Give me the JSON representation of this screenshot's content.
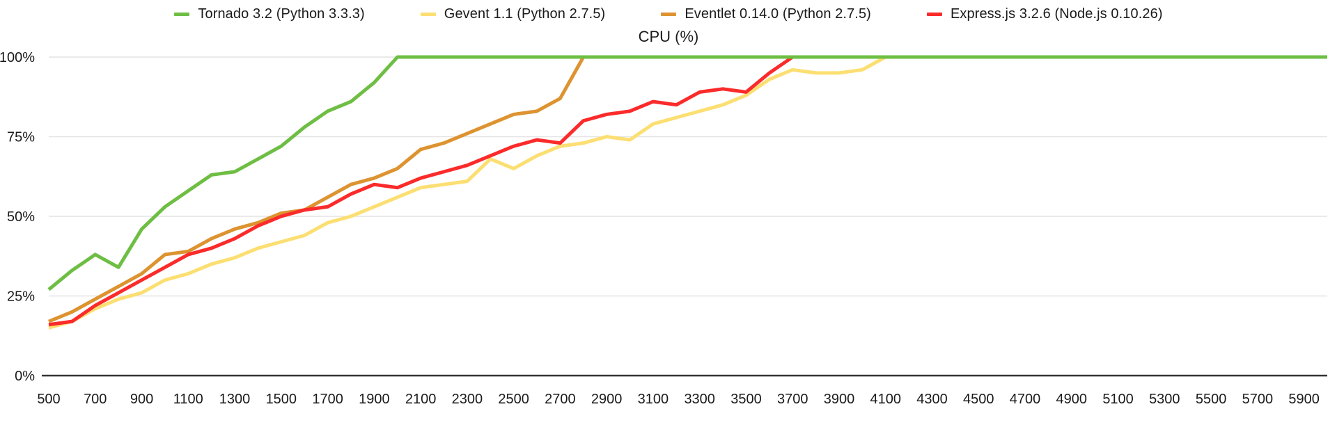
{
  "chart_data": {
    "type": "line",
    "title": "CPU (%)",
    "xlabel": "",
    "ylabel": "",
    "grid": true,
    "legend_position": "top",
    "xlim": [
      500,
      6000
    ],
    "ylim": [
      0,
      100
    ],
    "y_ticks": [
      0,
      25,
      50,
      75,
      100
    ],
    "y_tick_labels": [
      "0%",
      "25%",
      "50%",
      "75%",
      "100%"
    ],
    "x_tick_labels": [
      "500",
      "700",
      "900",
      "1100",
      "1300",
      "1500",
      "1700",
      "1900",
      "2100",
      "2300",
      "2500",
      "2700",
      "2900",
      "3100",
      "3300",
      "3500",
      "3700",
      "3900",
      "4100",
      "4300",
      "4500",
      "4700",
      "4900",
      "5100",
      "5300",
      "5500",
      "5700",
      "5900"
    ],
    "x": [
      500,
      600,
      700,
      800,
      900,
      1000,
      1100,
      1200,
      1300,
      1400,
      1500,
      1600,
      1700,
      1800,
      1900,
      2000,
      2100,
      2200,
      2300,
      2400,
      2500,
      2600,
      2700,
      2800,
      2900,
      3000,
      3100,
      3200,
      3300,
      3400,
      3500,
      3600,
      3700,
      3800,
      3900,
      4000,
      4100,
      4200,
      4300,
      4400,
      4500,
      4600,
      4700,
      4800,
      4900,
      5000,
      5100,
      5200,
      5300,
      5400,
      5500,
      5600,
      5700,
      5800,
      5900,
      6000
    ],
    "series": [
      {
        "name": "Tornado 3.2 (Python 3.3.3)",
        "color": "#6ebe44",
        "values": [
          27,
          33,
          38,
          34,
          46,
          53,
          58,
          63,
          64,
          68,
          72,
          78,
          83,
          86,
          92,
          100,
          100,
          100,
          100,
          100,
          100,
          100,
          100,
          100,
          100,
          100,
          100,
          100,
          100,
          100,
          100,
          100,
          100,
          100,
          100,
          100,
          100,
          100,
          100,
          100,
          100,
          100,
          100,
          100,
          100,
          100,
          100,
          100,
          100,
          100,
          100,
          100,
          100,
          100,
          100,
          100
        ]
      },
      {
        "name": "Gevent 1.1 (Python 2.7.5)",
        "color": "#fcdf72",
        "values": [
          15,
          17,
          21,
          24,
          26,
          30,
          32,
          35,
          37,
          40,
          42,
          44,
          48,
          50,
          53,
          56,
          59,
          60,
          61,
          68,
          65,
          69,
          72,
          73,
          75,
          74,
          79,
          81,
          83,
          85,
          88,
          93,
          96,
          95,
          95,
          96,
          100,
          100,
          100,
          100,
          100,
          100,
          100,
          100,
          100,
          100,
          100,
          100,
          100,
          100,
          100,
          100,
          100,
          100,
          100,
          100
        ]
      },
      {
        "name": "Eventlet 0.14.0 (Python 2.7.5)",
        "color": "#dd9330",
        "values": [
          17,
          20,
          24,
          28,
          32,
          38,
          39,
          43,
          46,
          48,
          51,
          52,
          56,
          60,
          62,
          65,
          71,
          73,
          76,
          79,
          82,
          83,
          87,
          100,
          100,
          100,
          100,
          100,
          100,
          100,
          100,
          100,
          100,
          100,
          100,
          100,
          100,
          100,
          100,
          100,
          100,
          100,
          100,
          100,
          100,
          100,
          100,
          100,
          100,
          100,
          100,
          100,
          100,
          100,
          100,
          100
        ]
      },
      {
        "name": "Express.js 3.2.6 (Node.js 0.10.26)",
        "color": "#fb2b2b",
        "values": [
          16,
          17,
          22,
          26,
          30,
          34,
          38,
          40,
          43,
          47,
          50,
          52,
          53,
          57,
          60,
          59,
          62,
          64,
          66,
          69,
          72,
          74,
          73,
          80,
          82,
          83,
          86,
          85,
          89,
          90,
          89,
          95,
          100,
          100,
          100,
          100,
          100,
          100,
          100,
          100,
          100,
          100,
          100,
          100,
          100,
          100,
          100,
          100,
          100,
          100,
          100,
          100,
          100,
          100,
          100,
          100
        ]
      }
    ]
  },
  "legend": {
    "items": [
      {
        "label": "Tornado 3.2 (Python 3.3.3)",
        "color": "#6ebe44"
      },
      {
        "label": "Gevent 1.1 (Python 2.7.5)",
        "color": "#fcdf72"
      },
      {
        "label": "Eventlet 0.14.0 (Python 2.7.5)",
        "color": "#dd9330"
      },
      {
        "label": "Express.js 3.2.6 (Node.js 0.10.26)",
        "color": "#fb2b2b"
      }
    ]
  },
  "title": "CPU (%)"
}
